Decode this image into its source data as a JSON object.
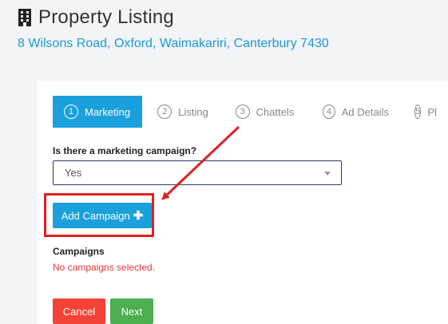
{
  "header": {
    "title": "Property Listing",
    "icon": "building-icon",
    "address": "8 Wilsons Road, Oxford, Waimakariri, Canterbury 7430"
  },
  "steps": [
    {
      "number": "1",
      "label": "Marketing",
      "active": true
    },
    {
      "number": "2",
      "label": "Listing",
      "active": false
    },
    {
      "number": "3",
      "label": "Chattels",
      "active": false
    },
    {
      "number": "4",
      "label": "Ad Details",
      "active": false
    },
    {
      "number": "5",
      "label": "Pl",
      "active": false
    }
  ],
  "form": {
    "campaign_question": "Is there a marketing campaign?",
    "campaign_value": "Yes",
    "add_campaign_label": "Add Campaign",
    "campaigns_heading": "Campaigns",
    "no_campaigns_text": "No campaigns selected."
  },
  "actions": {
    "cancel_label": "Cancel",
    "next_label": "Next"
  },
  "colors": {
    "accent": "#1aa0dc",
    "danger": "#f44336",
    "success": "#4caf50",
    "annotation": "#e02020"
  }
}
